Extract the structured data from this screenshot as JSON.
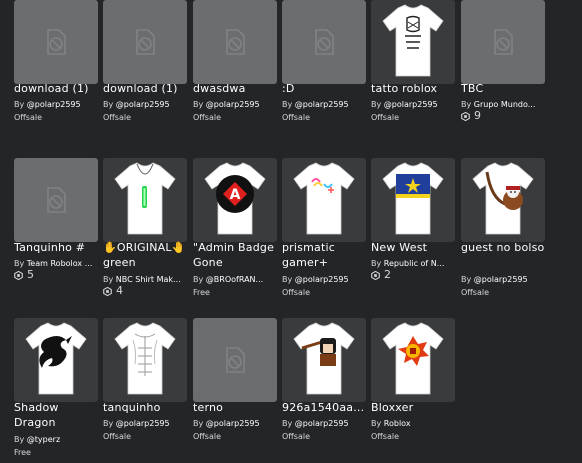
{
  "items": [
    {
      "name": "download (1)",
      "by_prefix": "By",
      "creator": "@polarp2595",
      "price": "Offsale",
      "thumb": "placeholder"
    },
    {
      "name": "download (1)",
      "by_prefix": "By",
      "creator": "@polarp2595",
      "price": "Offsale",
      "thumb": "placeholder"
    },
    {
      "name": "dwasdwa",
      "by_prefix": "By",
      "creator": "@polarp2595",
      "price": "Offsale",
      "thumb": "placeholder"
    },
    {
      "name": ":D",
      "by_prefix": "By",
      "creator": "@polarp2595",
      "price": "Offsale",
      "thumb": "placeholder"
    },
    {
      "name": "tatto roblox",
      "by_prefix": "By",
      "creator": "@polarp2595",
      "price": "Offsale",
      "thumb": "tattoo-shirt"
    },
    {
      "name": "TBC",
      "by_prefix": "By",
      "creator": "Grupo Mundo...",
      "price": "9",
      "price_type": "robux",
      "thumb": "placeholder"
    },
    {
      "name": "Tanquinho #",
      "by_prefix": "By",
      "creator": "Team Robolox ...",
      "price": "5",
      "price_type": "robux",
      "thumb": "placeholder"
    },
    {
      "name": "✋ORIGINAL🤚 green",
      "by_prefix": "By",
      "creator": "NBC Shirt Mak...",
      "price": "4",
      "price_type": "robux",
      "thumb": "green-necklace-shirt"
    },
    {
      "name": "\"Admin Badge Gone",
      "by_prefix": "By",
      "creator": "@BROofRAN...",
      "price": "Free",
      "thumb": "admin-badge-shirt"
    },
    {
      "name": "prismatic gamer+",
      "by_prefix": "By",
      "creator": "@polarp2595",
      "price": "Offsale",
      "thumb": "prismatic-shirt"
    },
    {
      "name": "New West",
      "by_prefix": "By",
      "creator": "Republic of N...",
      "price": "2",
      "price_type": "robux",
      "thumb": "flag-shirt"
    },
    {
      "name": "guest no bolso",
      "by_prefix": "By",
      "creator": "@polarp2595",
      "price": "Offsale",
      "thumb": "guest-shirt"
    },
    {
      "name": "Shadow Dragon",
      "by_prefix": "By",
      "creator": "@typerz",
      "price": "Free",
      "thumb": "dragon-shirt"
    },
    {
      "name": "tanquinho",
      "by_prefix": "By",
      "creator": "@polarp2595",
      "price": "Offsale",
      "thumb": "abs-shirt"
    },
    {
      "name": "terno",
      "by_prefix": "By",
      "creator": "@polarp2595",
      "price": "Offsale",
      "thumb": "placeholder"
    },
    {
      "name": "926a1540aa...",
      "by_prefix": "By",
      "creator": "@polarp2595",
      "price": "Offsale",
      "thumb": "character-shirt"
    },
    {
      "name": "Bloxxer",
      "by_prefix": "By",
      "creator": "Roblox",
      "price": "Offsale",
      "thumb": "bloxxer-shirt"
    }
  ],
  "colors": {
    "background": "#232527",
    "card_bg": "#393b3d",
    "placeholder_bg": "#6b6d6f",
    "text": "#ffffff",
    "subtext": "#d6d7d8"
  }
}
